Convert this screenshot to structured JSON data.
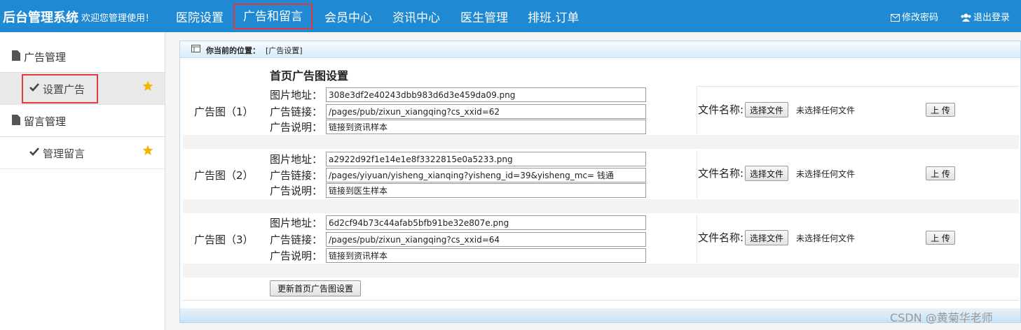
{
  "header": {
    "brand": "后台管理系统",
    "welcome": "欢迎您管理使用！",
    "nav": [
      "医院设置",
      "广告和留言",
      "会员中心",
      "资讯中心",
      "医生管理",
      "排班.订单"
    ],
    "change_password": "修改密码",
    "logout": "退出登录"
  },
  "sidebar": {
    "group1": "广告管理",
    "item1": "设置广告",
    "group2": "留言管理",
    "item2": "管理留言"
  },
  "breadcrumb": {
    "label": "你当前的位置：",
    "value": "[广告设置]"
  },
  "form": {
    "title": "首页广告图设置",
    "img_label": "图片地址：",
    "link_label": "广告链接：",
    "desc_label": "广告说明：",
    "file_label": "文件名称:",
    "choose_file": "选择文件",
    "no_file": "未选择任何文件",
    "upload": "上 传",
    "update_button": "更新首页广告图设置",
    "ads": [
      {
        "label": "广告图（1）",
        "img": "308e3df2e40243dbb983d6d3e459da09.png",
        "link": "/pages/pub/zixun_xiangqing?cs_xxid=62",
        "desc": "链接到资讯样本"
      },
      {
        "label": "广告图（2）",
        "img": "a2922d92f1e14e1e8f3322815e0a5233.png",
        "link": "/pages/yiyuan/yisheng_xianqing?yisheng_id=39&yisheng_mc= 钱通",
        "desc": "链接到医生样本"
      },
      {
        "label": "广告图（3）",
        "img": "6d2cf94b73c44afab5bfb91be32e807e.png",
        "link": "/pages/pub/zixun_xiangqing?cs_xxid=64",
        "desc": "链接到资讯样本"
      }
    ]
  },
  "watermark": "CSDN @黄菊华老师",
  "colors": {
    "header": "#1f8ad3",
    "highlight": "#e03a3a",
    "star": "#f5b400"
  }
}
